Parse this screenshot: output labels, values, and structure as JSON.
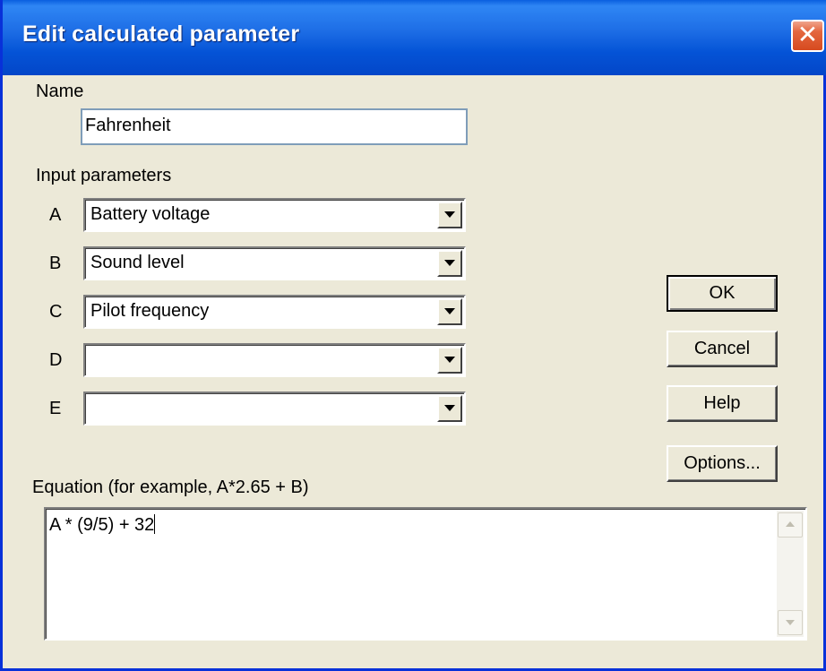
{
  "window": {
    "title": "Edit calculated parameter",
    "close_label": "✕"
  },
  "name": {
    "label": "Name",
    "value": "Fahrenheit"
  },
  "inputs": {
    "label": "Input parameters",
    "rows": [
      {
        "letter": "A",
        "value": "Battery voltage"
      },
      {
        "letter": "B",
        "value": "Sound level"
      },
      {
        "letter": "C",
        "value": "Pilot frequency"
      },
      {
        "letter": "D",
        "value": ""
      },
      {
        "letter": "E",
        "value": ""
      }
    ]
  },
  "buttons": {
    "ok": "OK",
    "cancel": "Cancel",
    "help": "Help",
    "options": "Options..."
  },
  "equation": {
    "label": "Equation (for example, A*2.65 + B)",
    "value": "A * (9/5) + 32"
  },
  "colors": {
    "titlebar": "#0453d6",
    "dialog_bg": "#ece9d8",
    "close_button": "#d64a1f"
  },
  "icons": {
    "close": "close-icon",
    "dropdown": "chevron-down-icon",
    "scroll_up": "scroll-up-icon",
    "scroll_down": "scroll-down-icon"
  }
}
